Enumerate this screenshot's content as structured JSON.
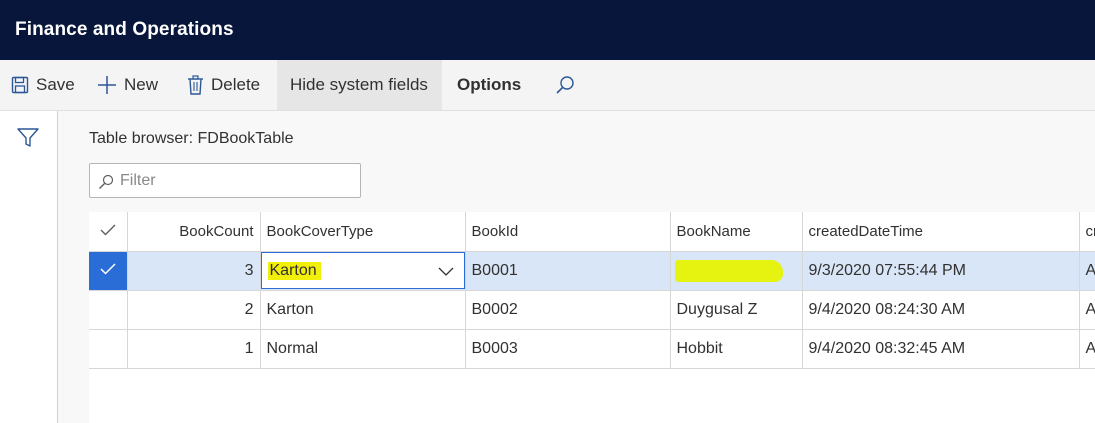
{
  "app": {
    "title": "Finance and Operations"
  },
  "toolbar": {
    "save_label": "Save",
    "new_label": "New",
    "delete_label": "Delete",
    "hide_system_fields_label": "Hide system fields",
    "options_label": "Options"
  },
  "page": {
    "title": "Table browser: FDBookTable",
    "filter_placeholder": "Filter"
  },
  "table": {
    "columns": [
      "BookCount",
      "BookCoverType",
      "BookId",
      "BookName",
      "createdDateTime",
      "cr"
    ],
    "rows": [
      {
        "BookCount": "3",
        "BookCoverType": "Karton",
        "BookId": "B0001",
        "BookName": "",
        "createdDateTime": "9/3/2020 07:55:44 PM",
        "cr": "A",
        "selected": true
      },
      {
        "BookCount": "2",
        "BookCoverType": "Karton",
        "BookId": "B0002",
        "BookName": "Duygusal Z",
        "createdDateTime": "9/4/2020 08:24:30 AM",
        "cr": "A",
        "selected": false
      },
      {
        "BookCount": "1",
        "BookCoverType": "Normal",
        "BookId": "B0003",
        "BookName": "Hobbit",
        "createdDateTime": "9/4/2020 08:32:45 AM",
        "cr": "A",
        "selected": false
      }
    ]
  },
  "icons": {
    "save": "save-icon",
    "new": "plus-icon",
    "delete": "trash-icon",
    "search": "search-icon",
    "filter": "filter-icon",
    "check": "check-icon",
    "dropdown": "chevron-down-icon"
  },
  "colors": {
    "header_bg": "#07163a",
    "accent": "#2a6dd6",
    "selected_row": "#d9e6f7",
    "highlight": "#f2f00a"
  }
}
